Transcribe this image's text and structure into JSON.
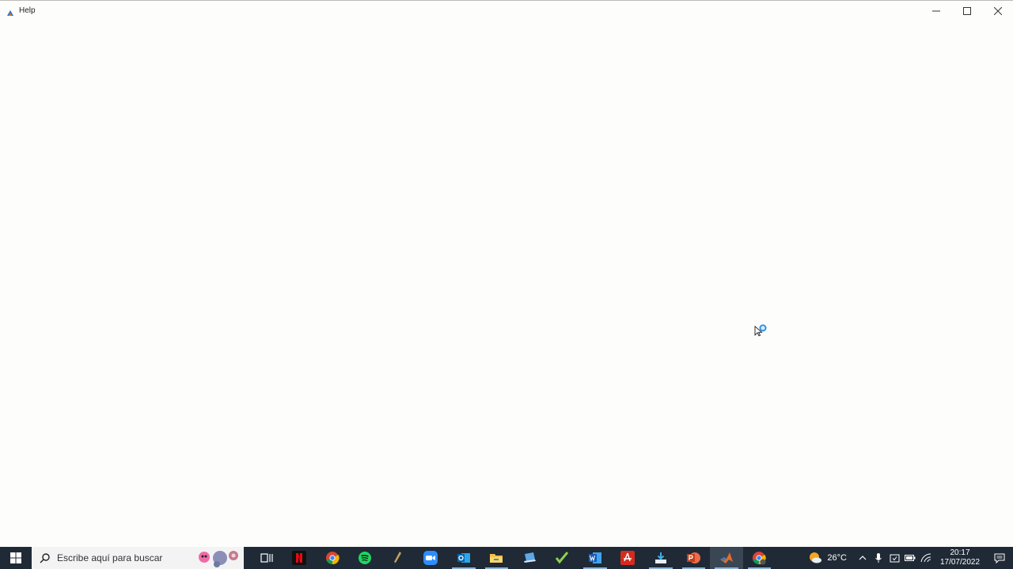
{
  "window": {
    "title": "Help",
    "icon": "help-app-icon",
    "controls": [
      "minimize-icon",
      "maximize-icon",
      "close-icon"
    ]
  },
  "cursor": "busy-pointer-icon",
  "taskbar": {
    "search_placeholder": "Escribe aquí para buscar",
    "apps": [
      {
        "name": "task-view-icon",
        "running": false
      },
      {
        "name": "netflix-icon",
        "running": false
      },
      {
        "name": "chrome-icon",
        "running": false
      },
      {
        "name": "spotify-icon",
        "running": false
      },
      {
        "name": "pen-tool-icon",
        "running": false
      },
      {
        "name": "zoom-icon",
        "running": false
      },
      {
        "name": "outlook-icon",
        "running": true
      },
      {
        "name": "file-explorer-icon",
        "running": true
      },
      {
        "name": "laptop-app-icon",
        "running": false
      },
      {
        "name": "checkmark-app-icon",
        "running": false
      },
      {
        "name": "word-icon",
        "running": true
      },
      {
        "name": "acrobat-icon",
        "running": false
      },
      {
        "name": "installer-icon",
        "running": true
      },
      {
        "name": "powerpoint-icon",
        "running": true
      },
      {
        "name": "matlab-icon",
        "running": true,
        "active": true
      },
      {
        "name": "chrome-profile-icon",
        "running": true
      }
    ],
    "weather": {
      "temperature": "26°C",
      "icon": "partly-sunny-icon"
    },
    "clock": {
      "time": "20:17",
      "date": "17/07/2022"
    },
    "colors": {
      "taskbar_bg": "#1f2a36",
      "search_bg": "#f3f3f3",
      "window_bg": "#fdfefc"
    }
  }
}
